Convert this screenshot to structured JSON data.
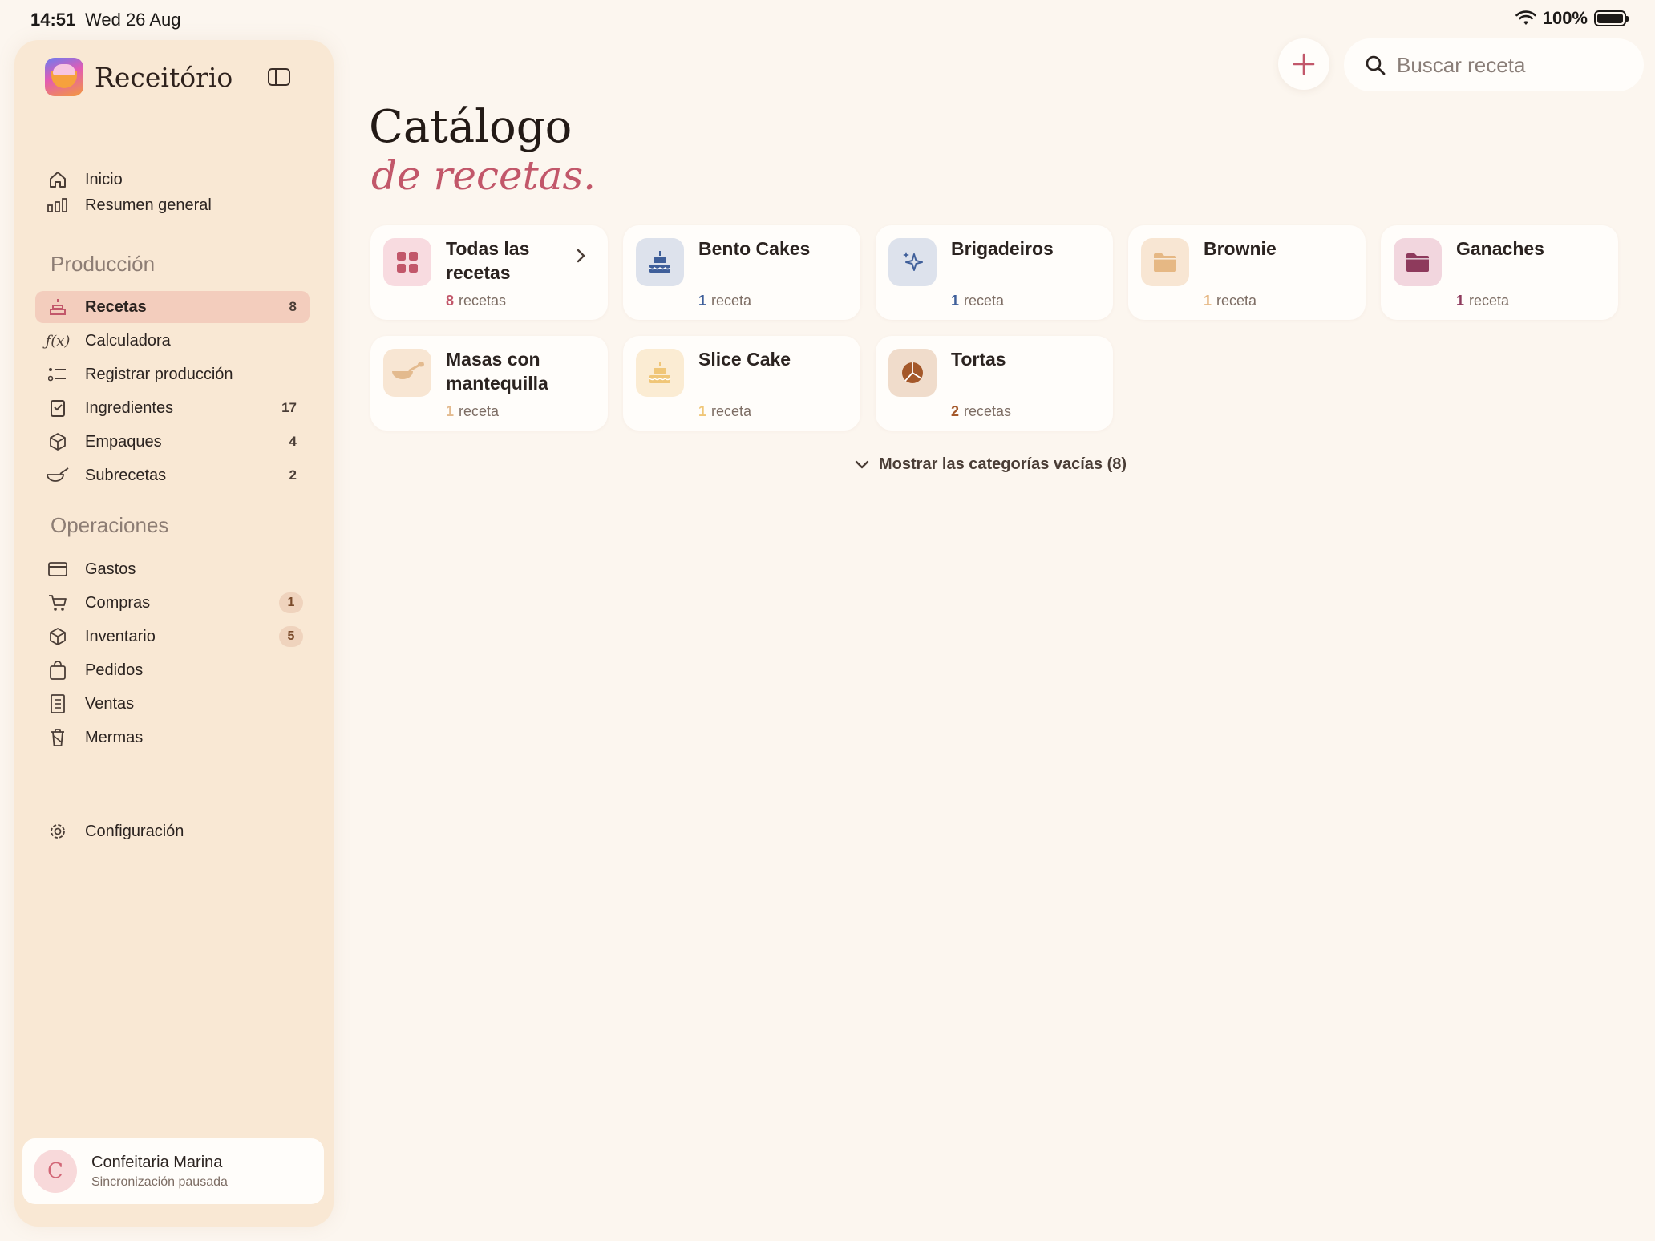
{
  "status_bar": {
    "time": "14:51",
    "date": "Wed 26 Aug",
    "battery": "100%"
  },
  "sidebar": {
    "app_name": "Receitório",
    "top_items": [
      {
        "label": "Inicio",
        "icon": "house-icon"
      },
      {
        "label": "Resumen general",
        "icon": "bar-chart-icon"
      }
    ],
    "sections": [
      {
        "title": "Producción",
        "items": [
          {
            "label": "Recetas",
            "icon": "cake-icon",
            "count": "8",
            "active": true
          },
          {
            "label": "Calculadora",
            "icon": "function-icon"
          },
          {
            "label": "Registrar producción",
            "icon": "list-checklist-icon"
          },
          {
            "label": "Ingredientes",
            "icon": "clipboard-icon",
            "count": "17"
          },
          {
            "label": "Empaques",
            "icon": "box-icon",
            "count": "4"
          },
          {
            "label": "Subrecetas",
            "icon": "bowl-whisk-icon",
            "count": "2"
          }
        ]
      },
      {
        "title": "Operaciones",
        "items": [
          {
            "label": "Gastos",
            "icon": "credit-card-icon"
          },
          {
            "label": "Compras",
            "icon": "cart-icon",
            "badge": "1"
          },
          {
            "label": "Inventario",
            "icon": "box-icon",
            "badge": "5"
          },
          {
            "label": "Pedidos",
            "icon": "bag-icon"
          },
          {
            "label": "Ventas",
            "icon": "receipt-icon"
          },
          {
            "label": "Mermas",
            "icon": "trash-icon"
          }
        ]
      }
    ],
    "settings_label": "Configuración",
    "account": {
      "initial": "C",
      "name": "Confeitaria Marina",
      "status": "Sincronización pausada"
    }
  },
  "main": {
    "search_placeholder": "Buscar receta",
    "title_line1": "Catálogo",
    "title_line2": "de recetas.",
    "categories": [
      {
        "name": "Todas las recetas",
        "count": "8",
        "unit": "recetas",
        "icon": "grid-icon",
        "color": "#c2576a",
        "bg": "#f8dbe0"
      },
      {
        "name": "Bento Cakes",
        "count": "1",
        "unit": "receta",
        "icon": "cake-icon",
        "color": "#3f5f9a",
        "bg": "#dde2ec"
      },
      {
        "name": "Brigadeiros",
        "count": "1",
        "unit": "receta",
        "icon": "sparkles-icon",
        "color": "#3f5f9a",
        "bg": "#dde2ec"
      },
      {
        "name": "Brownie",
        "count": "1",
        "unit": "receta",
        "icon": "folder-icon",
        "color": "#e6b884",
        "bg": "#f8e6d3"
      },
      {
        "name": "Ganaches",
        "count": "1",
        "unit": "receta",
        "icon": "folder-icon",
        "color": "#8e3a5c",
        "bg": "#f2d6de"
      },
      {
        "name": "Masas con mantequilla",
        "count": "1",
        "unit": "receta",
        "icon": "bowl-whisk-icon",
        "color": "#e3ba8e",
        "bg": "#f8e6d3"
      },
      {
        "name": "Slice Cake",
        "count": "1",
        "unit": "receta",
        "icon": "cake-icon",
        "color": "#f0c677",
        "bg": "#fbecd3"
      },
      {
        "name": "Tortas",
        "count": "2",
        "unit": "recetas",
        "icon": "pie-chart-icon",
        "color": "#a4582a",
        "bg": "#f0dccb"
      }
    ],
    "show_empty_label": "Mostrar las categorías vacías (8)"
  }
}
